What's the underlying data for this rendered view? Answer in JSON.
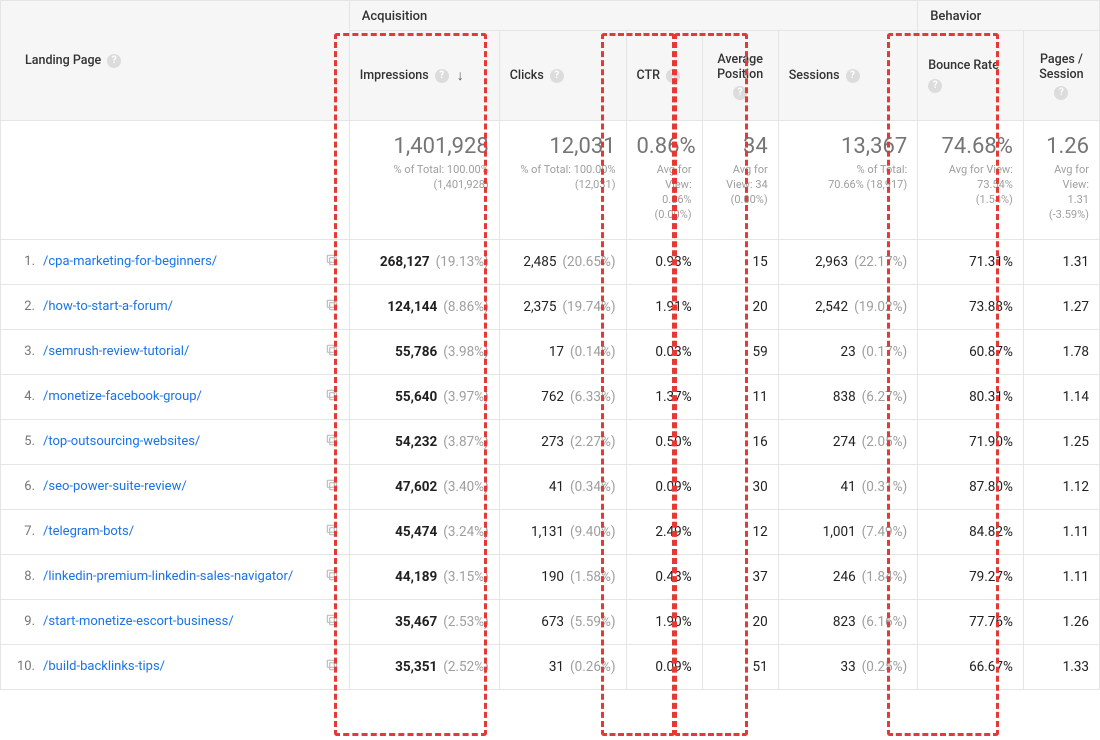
{
  "header": {
    "landing_page": "Landing Page",
    "groups": {
      "acquisition": "Acquisition",
      "behavior": "Behavior"
    },
    "cols": {
      "impressions": "Impressions",
      "clicks": "Clicks",
      "ctr": "CTR",
      "avg_position": "Average Position",
      "sessions": "Sessions",
      "bounce_rate": "Bounce Rate",
      "pages_session": "Pages / Session"
    }
  },
  "summary": {
    "impressions": {
      "big": "1,401,928",
      "line1": "% of Total: 100.00%",
      "line2": "(1,401,928)"
    },
    "clicks": {
      "big": "12,031",
      "line1": "% of Total: 100.00%",
      "line2": "(12,031)"
    },
    "ctr": {
      "big": "0.86%",
      "line1": "Avg for View:",
      "line2": "0.86%",
      "line3": "(0.00%)"
    },
    "avg_position": {
      "big": "34",
      "line1": "Avg for View: 34",
      "line2": "(0.00%)"
    },
    "sessions": {
      "big": "13,367",
      "line1": "% of Total:",
      "line2": "70.66% (18,917)"
    },
    "bounce_rate": {
      "big": "74.68%",
      "line1": "Avg for View:",
      "line2": "73.54%",
      "line3": "(1.54%)"
    },
    "pages_session": {
      "big": "1.26",
      "line1": "Avg for View:",
      "line2": "1.31",
      "line3": "(-3.59%)"
    }
  },
  "rows": [
    {
      "n": "1.",
      "page": "/cpa-marketing-for-beginners/",
      "impressions": "268,127",
      "impressions_pct": "(19.13%)",
      "clicks": "2,485",
      "clicks_pct": "(20.65%)",
      "ctr": "0.93%",
      "ap": "15",
      "sessions": "2,963",
      "sessions_pct": "(22.17%)",
      "br": "71.31%",
      "ps": "1.31"
    },
    {
      "n": "2.",
      "page": "/how-to-start-a-forum/",
      "impressions": "124,144",
      "impressions_pct": "(8.86%)",
      "clicks": "2,375",
      "clicks_pct": "(19.74%)",
      "ctr": "1.91%",
      "ap": "20",
      "sessions": "2,542",
      "sessions_pct": "(19.02%)",
      "br": "73.88%",
      "ps": "1.27"
    },
    {
      "n": "3.",
      "page": "/semrush-review-tutorial/",
      "impressions": "55,786",
      "impressions_pct": "(3.98%)",
      "clicks": "17",
      "clicks_pct": "(0.14%)",
      "ctr": "0.03%",
      "ap": "59",
      "sessions": "23",
      "sessions_pct": "(0.17%)",
      "br": "60.87%",
      "ps": "1.78"
    },
    {
      "n": "4.",
      "page": "/monetize-facebook-group/",
      "impressions": "55,640",
      "impressions_pct": "(3.97%)",
      "clicks": "762",
      "clicks_pct": "(6.33%)",
      "ctr": "1.37%",
      "ap": "11",
      "sessions": "838",
      "sessions_pct": "(6.27%)",
      "br": "80.31%",
      "ps": "1.14"
    },
    {
      "n": "5.",
      "page": "/top-outsourcing-websites/",
      "impressions": "54,232",
      "impressions_pct": "(3.87%)",
      "clicks": "273",
      "clicks_pct": "(2.27%)",
      "ctr": "0.50%",
      "ap": "16",
      "sessions": "274",
      "sessions_pct": "(2.05%)",
      "br": "71.90%",
      "ps": "1.25"
    },
    {
      "n": "6.",
      "page": "/seo-power-suite-review/",
      "impressions": "47,602",
      "impressions_pct": "(3.40%)",
      "clicks": "41",
      "clicks_pct": "(0.34%)",
      "ctr": "0.09%",
      "ap": "30",
      "sessions": "41",
      "sessions_pct": "(0.31%)",
      "br": "87.80%",
      "ps": "1.12"
    },
    {
      "n": "7.",
      "page": "/telegram-bots/",
      "impressions": "45,474",
      "impressions_pct": "(3.24%)",
      "clicks": "1,131",
      "clicks_pct": "(9.40%)",
      "ctr": "2.49%",
      "ap": "12",
      "sessions": "1,001",
      "sessions_pct": "(7.49%)",
      "br": "84.82%",
      "ps": "1.11"
    },
    {
      "n": "8.",
      "page": "/linkedin-premium-linkedin-sales-navigator/",
      "impressions": "44,189",
      "impressions_pct": "(3.15%)",
      "clicks": "190",
      "clicks_pct": "(1.58%)",
      "ctr": "0.43%",
      "ap": "37",
      "sessions": "246",
      "sessions_pct": "(1.84%)",
      "br": "79.27%",
      "ps": "1.11"
    },
    {
      "n": "9.",
      "page": "/start-monetize-escort-business/",
      "impressions": "35,467",
      "impressions_pct": "(2.53%)",
      "clicks": "673",
      "clicks_pct": "(5.59%)",
      "ctr": "1.90%",
      "ap": "20",
      "sessions": "823",
      "sessions_pct": "(6.16%)",
      "br": "77.76%",
      "ps": "1.26"
    },
    {
      "n": "10.",
      "page": "/build-backlinks-tips/",
      "impressions": "35,351",
      "impressions_pct": "(2.52%)",
      "clicks": "31",
      "clicks_pct": "(0.26%)",
      "ctr": "0.09%",
      "ap": "51",
      "sessions": "33",
      "sessions_pct": "(0.25%)",
      "br": "66.67%",
      "ps": "1.33"
    }
  ],
  "chart_data": {
    "type": "table",
    "columns": [
      "Landing Page",
      "Impressions",
      "Clicks",
      "CTR",
      "Average Position",
      "Sessions",
      "Bounce Rate",
      "Pages / Session"
    ],
    "highlighted_columns": [
      "Impressions",
      "CTR",
      "Average Position",
      "Bounce Rate"
    ],
    "totals": {
      "Impressions": 1401928,
      "Clicks": 12031,
      "CTR": 0.86,
      "Average Position": 34,
      "Sessions": 13367,
      "Bounce Rate": 74.68,
      "Pages / Session": 1.26
    },
    "rows": [
      {
        "Landing Page": "/cpa-marketing-for-beginners/",
        "Impressions": 268127,
        "Clicks": 2485,
        "CTR": 0.93,
        "Average Position": 15,
        "Sessions": 2963,
        "Bounce Rate": 71.31,
        "Pages / Session": 1.31
      },
      {
        "Landing Page": "/how-to-start-a-forum/",
        "Impressions": 124144,
        "Clicks": 2375,
        "CTR": 1.91,
        "Average Position": 20,
        "Sessions": 2542,
        "Bounce Rate": 73.88,
        "Pages / Session": 1.27
      },
      {
        "Landing Page": "/semrush-review-tutorial/",
        "Impressions": 55786,
        "Clicks": 17,
        "CTR": 0.03,
        "Average Position": 59,
        "Sessions": 23,
        "Bounce Rate": 60.87,
        "Pages / Session": 1.78
      },
      {
        "Landing Page": "/monetize-facebook-group/",
        "Impressions": 55640,
        "Clicks": 762,
        "CTR": 1.37,
        "Average Position": 11,
        "Sessions": 838,
        "Bounce Rate": 80.31,
        "Pages / Session": 1.14
      },
      {
        "Landing Page": "/top-outsourcing-websites/",
        "Impressions": 54232,
        "Clicks": 273,
        "CTR": 0.5,
        "Average Position": 16,
        "Sessions": 274,
        "Bounce Rate": 71.9,
        "Pages / Session": 1.25
      },
      {
        "Landing Page": "/seo-power-suite-review/",
        "Impressions": 47602,
        "Clicks": 41,
        "CTR": 0.09,
        "Average Position": 30,
        "Sessions": 41,
        "Bounce Rate": 87.8,
        "Pages / Session": 1.12
      },
      {
        "Landing Page": "/telegram-bots/",
        "Impressions": 45474,
        "Clicks": 1131,
        "CTR": 2.49,
        "Average Position": 12,
        "Sessions": 1001,
        "Bounce Rate": 84.82,
        "Pages / Session": 1.11
      },
      {
        "Landing Page": "/linkedin-premium-linkedin-sales-navigator/",
        "Impressions": 44189,
        "Clicks": 190,
        "CTR": 0.43,
        "Average Position": 37,
        "Sessions": 246,
        "Bounce Rate": 79.27,
        "Pages / Session": 1.11
      },
      {
        "Landing Page": "/start-monetize-escort-business/",
        "Impressions": 35467,
        "Clicks": 673,
        "CTR": 1.9,
        "Average Position": 20,
        "Sessions": 823,
        "Bounce Rate": 77.76,
        "Pages / Session": 1.26
      },
      {
        "Landing Page": "/build-backlinks-tips/",
        "Impressions": 35351,
        "Clicks": 31,
        "CTR": 0.09,
        "Average Position": 51,
        "Sessions": 33,
        "Bounce Rate": 66.67,
        "Pages / Session": 1.33
      }
    ]
  }
}
